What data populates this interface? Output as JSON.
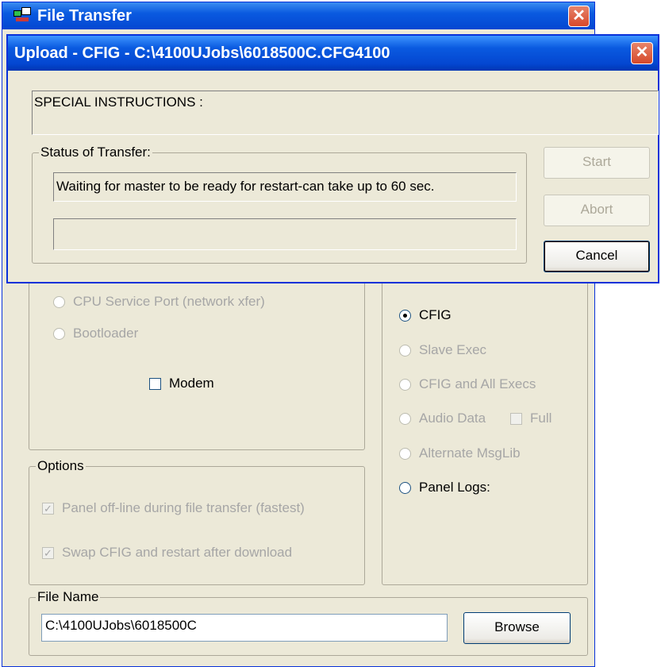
{
  "back_window": {
    "title": "File Transfer",
    "close_glyph": "✕",
    "icon": "computer-transfer-icon",
    "transfer_group": {
      "cpu_service_port": "CPU Service Port (network xfer)",
      "bootloader": "Bootloader",
      "modem": "Modem"
    },
    "type_group": {
      "cfig": "CFIG",
      "slave_exec": "Slave Exec",
      "cfig_all_execs": "CFIG and All Execs",
      "audio_data": "Audio Data",
      "full": "Full",
      "alternate_msglib": "Alternate MsgLib",
      "panel_logs": "Panel Logs:"
    },
    "options": {
      "label": "Options",
      "offline": "Panel off-line during file transfer (fastest)",
      "swap": "Swap CFIG and restart after download"
    },
    "file_name": {
      "label": "File Name",
      "value": "C:\\4100UJobs\\6018500C",
      "browse": "Browse"
    }
  },
  "dialog": {
    "title": "Upload - CFIG - C:\\4100UJobs\\6018500C.CFG4100",
    "close_glyph": "✕",
    "special_instructions": "SPECIAL INSTRUCTIONS :",
    "status_label": "Status of Transfer:",
    "status_text": "Waiting for master to be ready for restart-can take up to 60 sec.",
    "progress_text": "",
    "start": "Start",
    "abort": "Abort",
    "cancel": "Cancel"
  },
  "colors": {
    "titlebar": "#0a5ae0",
    "window_bg": "#ece9d8",
    "close_red": "#d6482a"
  }
}
